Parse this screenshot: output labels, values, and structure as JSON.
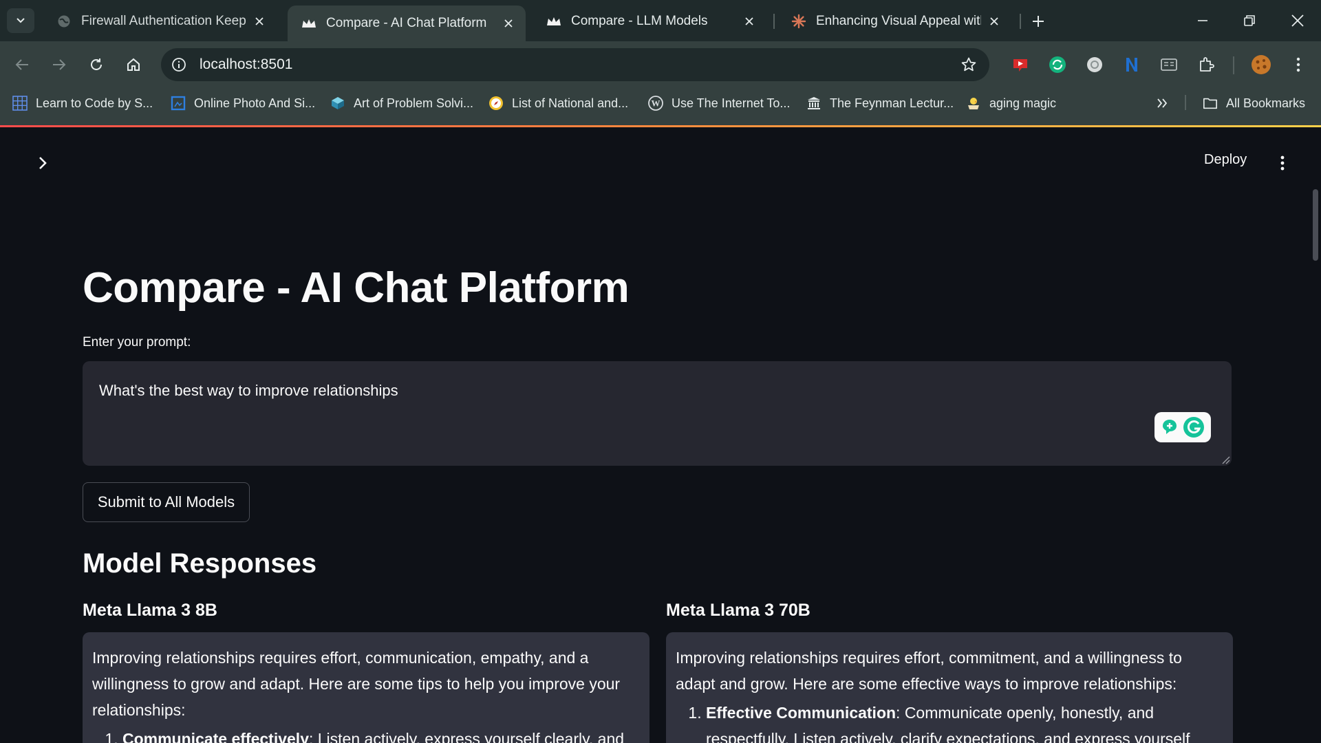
{
  "browser": {
    "tabs": [
      {
        "title": "Firewall Authentication Keepaliv",
        "favicon": "globe-icon",
        "active": false
      },
      {
        "title": "Compare - AI Chat Platform",
        "favicon": "streamlit-crown-icon",
        "active": true
      },
      {
        "title": "Compare - LLM Models",
        "favicon": "streamlit-crown-icon",
        "active": false
      },
      {
        "title": "Enhancing Visual Appeal with C",
        "favicon": "claude-sunburst-icon",
        "active": false
      }
    ],
    "url": "localhost:8501",
    "bookmarks": [
      {
        "label": "Learn to Code by S...",
        "icon": "grid-icon"
      },
      {
        "label": "Online Photo And Si...",
        "icon": "photo-editor-icon"
      },
      {
        "label": "Art of Problem Solvi...",
        "icon": "aops-icon"
      },
      {
        "label": "List of National and...",
        "icon": "compass-icon"
      },
      {
        "label": "Use The Internet To...",
        "icon": "wordpress-icon"
      },
      {
        "label": "The Feynman Lectur...",
        "icon": "building-icon"
      },
      {
        "label": "aging magic",
        "icon": "chick-icon"
      }
    ],
    "all_bookmarks_label": "All Bookmarks",
    "colors": {
      "tabbar": "#1f2a2b",
      "toolbar": "#34403f"
    }
  },
  "app": {
    "deploy_label": "Deploy",
    "title": "Compare - AI Chat Platform",
    "prompt_label": "Enter your prompt:",
    "prompt_value": "What's the best way to improve relationships",
    "submit_label": "Submit to All Models",
    "section_title": "Model Responses",
    "responses": [
      {
        "model": "Meta Llama 3 8B",
        "intro": "Improving relationships requires effort, communication, empathy, and a willingness to grow and adapt. Here are some tips to help you improve your relationships:",
        "first_item_title": "Communicate effectively",
        "first_item_text": ": Listen actively, express yourself clearly, and"
      },
      {
        "model": "Meta Llama 3 70B",
        "intro": "Improving relationships requires effort, commitment, and a willingness to adapt and grow. Here are some effective ways to improve relationships:",
        "first_item_title": "Effective Communication",
        "first_item_text": ": Communicate openly, honestly, and respectfully. Listen actively, clarify expectations, and express yourself"
      }
    ],
    "colors": {
      "background": "#0e1117",
      "input_bg": "#262730",
      "card_bg": "#31333f",
      "accent_gradient_start": "#ff4b4b"
    }
  }
}
